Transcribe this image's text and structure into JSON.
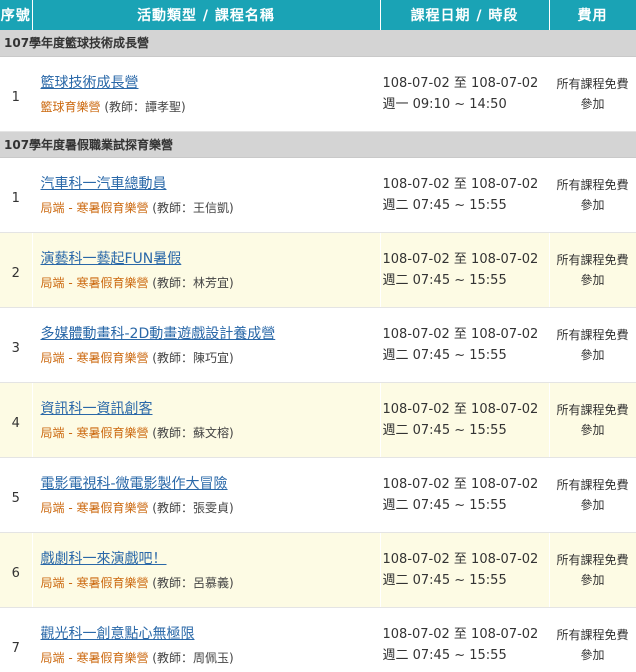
{
  "header": {
    "no": "序號",
    "name": "活動類型 / 課程名稱",
    "date": "課程日期 / 時段",
    "fee": "費用"
  },
  "groups": [
    {
      "title": "107學年度籃球技術成長營",
      "courses": [
        {
          "no": "1",
          "title": "籃球技術成長營",
          "org": "籃球育樂營",
          "teacher": "(教師：譚孝聖)",
          "date": "108-07-02 至 108-07-02",
          "time": "週一 09:10 ~ 14:50",
          "fee": "所有課程免費參加"
        }
      ]
    },
    {
      "title": "107學年度暑假職業試探育樂營",
      "courses": [
        {
          "no": "1",
          "title": "汽車科一汽車總動員",
          "org": "局端 - 寒暑假育樂營",
          "teacher": "(教師：王信凱)",
          "date": "108-07-02 至 108-07-02",
          "time": "週二 07:45 ~ 15:55",
          "fee": "所有課程免費參加"
        },
        {
          "no": "2",
          "title": "演藝科一藝起FUN暑假",
          "org": "局端 - 寒暑假育樂營",
          "teacher": "(教師：林芳宜)",
          "date": "108-07-02 至 108-07-02",
          "time": "週二 07:45 ~ 15:55",
          "fee": "所有課程免費參加"
        },
        {
          "no": "3",
          "title": "多媒體動畫科-2D動畫遊戲設計養成營",
          "org": "局端 - 寒暑假育樂營",
          "teacher": "(教師：陳巧宜)",
          "date": "108-07-02 至 108-07-02",
          "time": "週二 07:45 ~ 15:55",
          "fee": "所有課程免費參加"
        },
        {
          "no": "4",
          "title": "資訊科一資訊創客",
          "org": "局端 - 寒暑假育樂營",
          "teacher": "(教師：蘇文榕)",
          "date": "108-07-02 至 108-07-02",
          "time": "週二 07:45 ~ 15:55",
          "fee": "所有課程免費參加"
        },
        {
          "no": "5",
          "title": "電影電視科-微電影製作大冒險",
          "org": "局端 - 寒暑假育樂營",
          "teacher": "(教師：張雯貞)",
          "date": "108-07-02 至 108-07-02",
          "time": "週二 07:45 ~ 15:55",
          "fee": "所有課程免費參加"
        },
        {
          "no": "6",
          "title": "戲劇科一來演戲吧！",
          "org": "局端 - 寒暑假育樂營",
          "teacher": "(教師：呂慕義)",
          "date": "108-07-02 至 108-07-02",
          "time": "週二 07:45 ~ 15:55",
          "fee": "所有課程免費參加"
        },
        {
          "no": "7",
          "title": "觀光科一創意點心無極限",
          "org": "局端 - 寒暑假育樂營",
          "teacher": "(教師：周佩玉)",
          "date": "108-07-02 至 108-07-02",
          "time": "週二 07:45 ~ 15:55",
          "fee": "所有課程免費參加"
        }
      ]
    }
  ],
  "colors": {
    "header_bg": "#1aa3b5",
    "group_bg": "#d4d4d4",
    "link": "#2a68a8",
    "org": "#cc6a11",
    "row_alt": "#fdfbe4"
  }
}
